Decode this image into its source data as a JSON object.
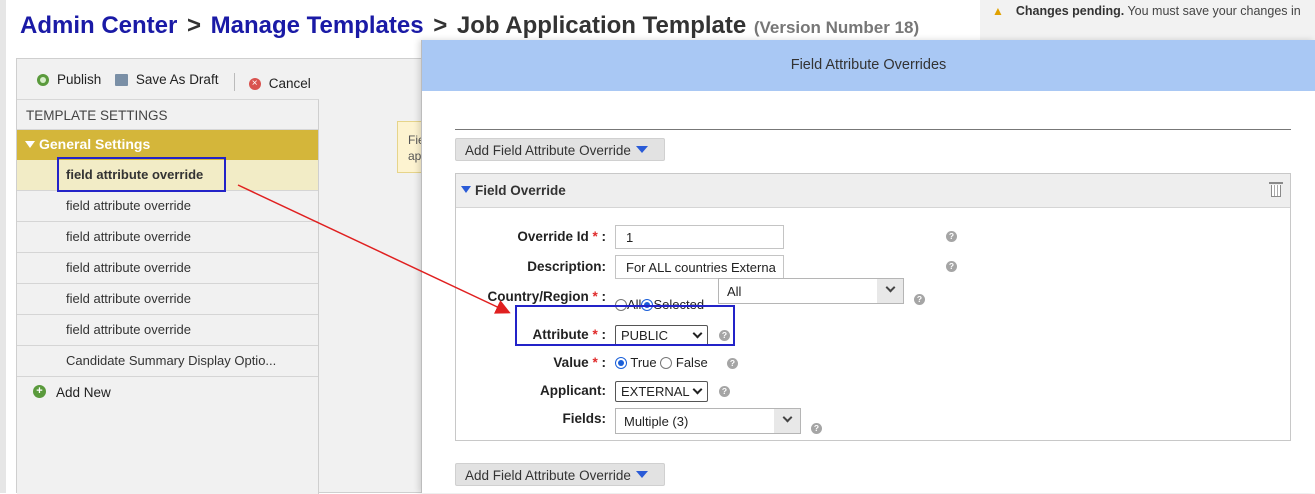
{
  "breadcrumb": {
    "admin_center": "Admin Center",
    "sep1": ">",
    "manage_templates": "Manage Templates",
    "sep2": ">",
    "current": "Job Application Template",
    "version": "(Version Number 18)"
  },
  "notification": {
    "icon": "warning-icon",
    "title": "Changes pending.",
    "text": "You must save your changes in"
  },
  "toolbar": {
    "publish_label": "Publish",
    "save_draft_label": "Save As Draft",
    "cancel_label": "Cancel"
  },
  "sidebar": {
    "heading": "TEMPLATE SETTINGS",
    "group_label": "General Settings",
    "items": [
      {
        "label": "field attribute override",
        "selected": true
      },
      {
        "label": "field attribute override"
      },
      {
        "label": "field attribute override"
      },
      {
        "label": "field attribute override"
      },
      {
        "label": "field attribute override"
      },
      {
        "label": "field attribute override"
      },
      {
        "label": "Candidate Summary Display Optio..."
      }
    ],
    "add_new_label": "Add New"
  },
  "notice": {
    "line1": "Fie",
    "line2": "ap"
  },
  "dialog": {
    "title": "Field Attribute Overrides",
    "add_override_label": "Add Field Attribute Override",
    "panel_title": "Field Override",
    "fields": {
      "override_id_label": "Override Id",
      "override_id_value": "1",
      "description_label": "Description:",
      "description_value": "For ALL countries Externa",
      "country_label": "Country/Region",
      "country_all_label": "All",
      "country_selected_label": "Selected",
      "country_value": "All",
      "attribute_label": "Attribute",
      "attribute_value": "PUBLIC",
      "value_label": "Value",
      "value_true_label": "True",
      "value_false_label": "False",
      "applicant_label": "Applicant:",
      "applicant_value": "EXTERNAL",
      "fields_label": "Fields:",
      "fields_value": "Multiple (3)"
    },
    "required_mark": "*",
    "colon": ":"
  },
  "colors": {
    "breadcrumb_link": "#1a1aa6",
    "dialog_header": "#a9c8f4",
    "group_header": "#d4b63a",
    "callout_border": "#2323c8",
    "arrow": "#e02020"
  }
}
